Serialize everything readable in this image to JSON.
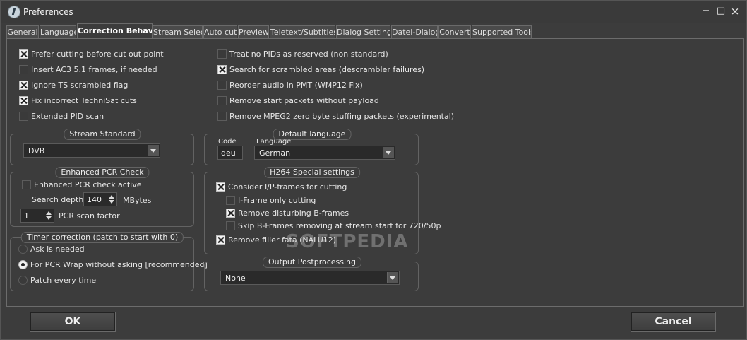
{
  "window": {
    "title": "Preferences",
    "min_label": "−",
    "max_label": "□",
    "close_label": "×"
  },
  "tabs": [
    {
      "label": "General"
    },
    {
      "label": "Language"
    },
    {
      "label": "Correction Behav..."
    },
    {
      "label": "Stream Select"
    },
    {
      "label": "Auto cut"
    },
    {
      "label": "Preview"
    },
    {
      "label": "Teletext/Subtitles"
    },
    {
      "label": "Dialog Settings"
    },
    {
      "label": "Datei-Dialog"
    },
    {
      "label": "Convert"
    },
    {
      "label": "Supported Tools"
    }
  ],
  "active_tab": "Correction Behav...",
  "options_left": [
    {
      "label": "Prefer cutting before cut out point",
      "checked": true
    },
    {
      "label": "Insert AC3 5.1 frames, if needed",
      "checked": false
    },
    {
      "label": "Ignore TS scrambled flag",
      "checked": true
    },
    {
      "label": "Fix incorrect TechniSat cuts",
      "checked": true
    },
    {
      "label": "Extended PID scan",
      "checked": false
    }
  ],
  "options_right": [
    {
      "label": "Treat no PIDs as reserved (non standard)",
      "checked": false
    },
    {
      "label": "Search for scrambled areas (descrambler failures)",
      "checked": true
    },
    {
      "label": "Reorder audio in PMT (WMP12 Fix)",
      "checked": false
    },
    {
      "label": "Remove start packets without payload",
      "checked": false
    },
    {
      "label": "Remove MPEG2 zero byte stuffing packets (experimental)",
      "checked": false
    }
  ],
  "stream_standard": {
    "title": "Stream Standard",
    "value": "DVB"
  },
  "pcr_check": {
    "title": "Enhanced PCR Check",
    "active_label": "Enhanced PCR check active",
    "active_checked": false,
    "search_depth_label": "Search depth",
    "search_depth_value": "140",
    "search_depth_unit": "MBytes",
    "scan_factor_value": "1",
    "scan_factor_label": "PCR scan factor"
  },
  "timer_correction": {
    "title": "Timer correction (patch to start with 0)",
    "options": [
      {
        "label": "Ask is needed",
        "selected": false
      },
      {
        "label": "For PCR Wrap without asking [recommended]",
        "selected": true
      },
      {
        "label": "Patch every time",
        "selected": false
      }
    ]
  },
  "default_language": {
    "title": "Default language",
    "code_label": "Code",
    "code_value": "deu",
    "language_label": "Language",
    "language_value": "German"
  },
  "h264": {
    "title": "H264 Special settings",
    "consider_ip": {
      "label": "Consider I/P-frames for cutting",
      "checked": true
    },
    "iframe_only": {
      "label": "I-Frame only cutting",
      "checked": false
    },
    "remove_bframes": {
      "label": "Remove disturbing B-frames",
      "checked": true
    },
    "skip_bframes": {
      "label": "Skip B-Frames removing at stream start for 720/50p",
      "checked": false
    },
    "remove_filler": {
      "label": "Remove filler fata (NALU12)",
      "checked": true
    }
  },
  "output_post": {
    "title": "Output Postprocessing",
    "value": "None"
  },
  "buttons": {
    "ok": "OK",
    "cancel": "Cancel"
  },
  "watermark": "SOFTPEDIA"
}
